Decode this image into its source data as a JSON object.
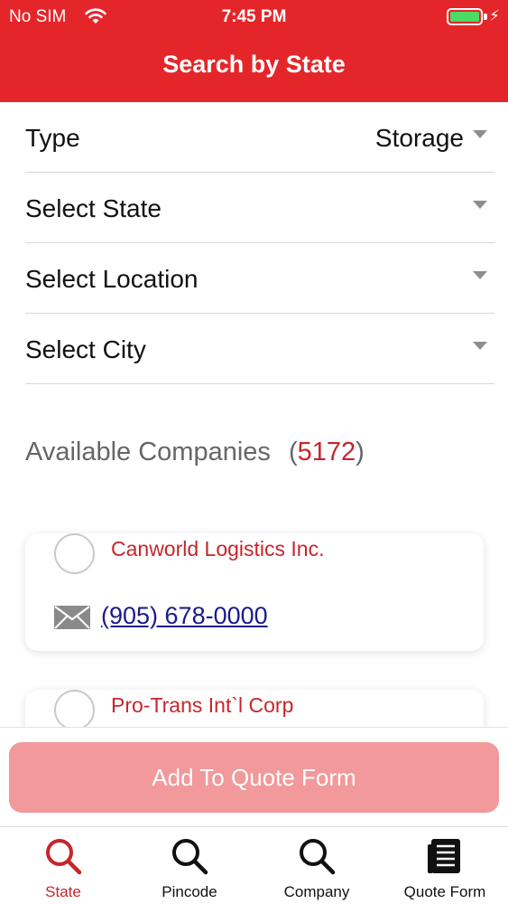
{
  "status_bar": {
    "carrier": "No SIM",
    "time": "7:45 PM"
  },
  "header": {
    "title": "Search by State"
  },
  "filters": {
    "type": {
      "label": "Type",
      "value": "Storage"
    },
    "state": {
      "label": "Select State"
    },
    "location": {
      "label": "Select Location"
    },
    "city": {
      "label": "Select City"
    }
  },
  "available": {
    "label": "Available Companies",
    "open": "(",
    "count": "5172",
    "close": ")"
  },
  "companies": [
    {
      "name": "Canworld Logistics Inc.",
      "phone": "(905) 678-0000"
    },
    {
      "name": "Pro-Trans Int`l Corp"
    }
  ],
  "add_button": {
    "label": "Add To Quote Form"
  },
  "tabs": [
    {
      "label": "State",
      "icon": "search-icon",
      "active": true
    },
    {
      "label": "Pincode",
      "icon": "search-icon"
    },
    {
      "label": "Company",
      "icon": "search-icon"
    },
    {
      "label": "Quote Form",
      "icon": "document-list-icon"
    }
  ],
  "colors": {
    "brand": "#e4262a",
    "accent_text": "#c6262b",
    "button_disabled": "#f1999b",
    "link": "#1a1a8c"
  }
}
